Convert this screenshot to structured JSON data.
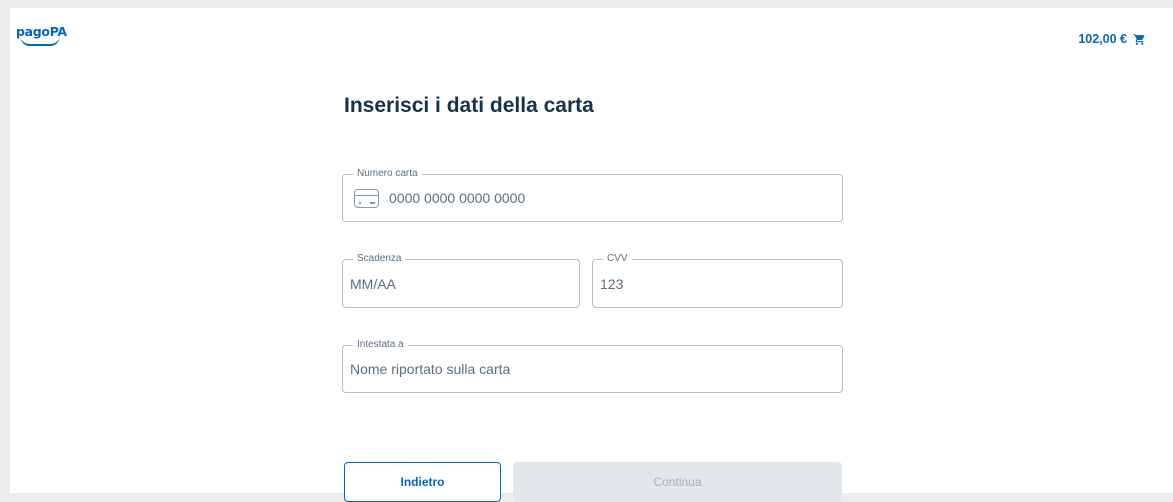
{
  "header": {
    "logo_text": "pagoPA",
    "cart_amount": "102,00 €",
    "cart_icon": "cart-icon"
  },
  "form": {
    "title": "Inserisci i dati della carta",
    "card_number": {
      "label": "Numero carta",
      "placeholder": "0000 0000 0000 0000",
      "icon": "credit-card-icon"
    },
    "expiry": {
      "label": "Scadenza",
      "placeholder": "MM/AA"
    },
    "cvv": {
      "label": "CVV",
      "placeholder": "123"
    },
    "holder": {
      "label": "Intestata a",
      "placeholder": "Nome riportato sulla carta"
    }
  },
  "actions": {
    "back_label": "Indietro",
    "continue_label": "Continua"
  },
  "colors": {
    "brand": "#0066cc",
    "title": "#17324d",
    "disabled_bg": "#e3e7eb"
  }
}
